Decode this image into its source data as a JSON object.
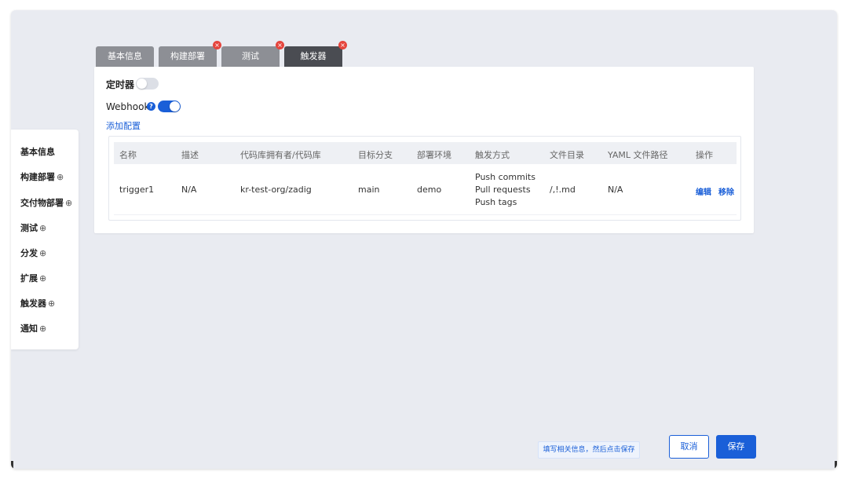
{
  "tabs": [
    {
      "label": "基本信息",
      "closable": false,
      "active": false
    },
    {
      "label": "构建部署",
      "closable": true,
      "active": false
    },
    {
      "label": "测试",
      "closable": true,
      "active": false
    },
    {
      "label": "触发器",
      "closable": true,
      "active": true
    }
  ],
  "timer": {
    "label": "定时器",
    "enabled": false
  },
  "webhook": {
    "label": "Webhook",
    "help": "?",
    "enabled": true
  },
  "add_config": "添加配置",
  "table": {
    "headers": [
      "名称",
      "描述",
      "代码库拥有者/代码库",
      "目标分支",
      "部署环境",
      "触发方式",
      "文件目录",
      "YAML 文件路径",
      "操作"
    ],
    "rows": [
      {
        "name": "trigger1",
        "desc": "N/A",
        "repo": "kr-test-org/zadig",
        "branch": "main",
        "env": "demo",
        "events": [
          "Push commits",
          "Pull requests",
          "Push tags"
        ],
        "dir": "/,!.md",
        "yaml": "N/A",
        "edit": "编辑",
        "remove": "移除"
      }
    ]
  },
  "sidebar": {
    "items": [
      {
        "label": "基本信息",
        "plus": ""
      },
      {
        "label": "构建部署",
        "plus": "⊕"
      },
      {
        "label": "交付物部署",
        "plus": "⊕"
      },
      {
        "label": "测试",
        "plus": "⊕"
      },
      {
        "label": "分发",
        "plus": "⊕"
      },
      {
        "label": "扩展",
        "plus": "⊕"
      },
      {
        "label": "触发器",
        "plus": "⊕"
      },
      {
        "label": "通知",
        "plus": "⊕"
      }
    ]
  },
  "footer": {
    "hint": "填写相关信息，然后点击保存",
    "cancel": "取消",
    "save": "保存"
  },
  "colors": {
    "accent": "#1a5fd8",
    "tab_inactive": "#8d8f95",
    "tab_active": "#4a4c52",
    "close_badge": "#e5453d"
  }
}
